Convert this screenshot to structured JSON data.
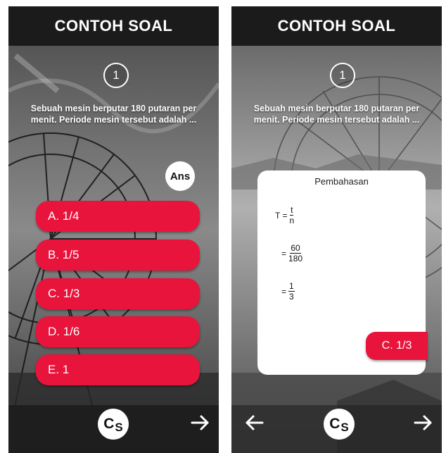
{
  "left_screen": {
    "header_title": "CONTOH SOAL",
    "question_number": "1",
    "question_text": "Sebuah mesin berputar 180 putaran per menit. Periode mesin tersebut adalah ...",
    "ans_label": "Ans",
    "options": [
      "A. 1/4",
      "B. 1/5",
      "C. 1/3",
      "D. 1/6",
      "E. 1"
    ],
    "cs_label": "C",
    "cs_sub": "S",
    "next_icon": "right-arrow-icon"
  },
  "right_screen": {
    "header_title": "CONTOH SOAL",
    "question_number": "1",
    "question_text": "Sebuah mesin berputar 180 putaran per menit. Periode mesin tersebut adalah ...",
    "card_title": "Pembahasan",
    "formula": {
      "step1_lhs": "T = ",
      "step1_num": "t",
      "step1_den": "n",
      "step2_lhs": "= ",
      "step2_num": "60",
      "step2_den": "180",
      "step3_lhs": "= ",
      "step3_num": "1",
      "step3_den": "3"
    },
    "answer_label": "C. 1/3",
    "cs_label": "C",
    "cs_sub": "S",
    "prev_icon": "left-arrow-icon",
    "next_icon": "right-arrow-icon"
  },
  "colors": {
    "accent_red": "#e8143c",
    "header_bg": "#1b1b1b",
    "card_bg": "#ffffff"
  }
}
